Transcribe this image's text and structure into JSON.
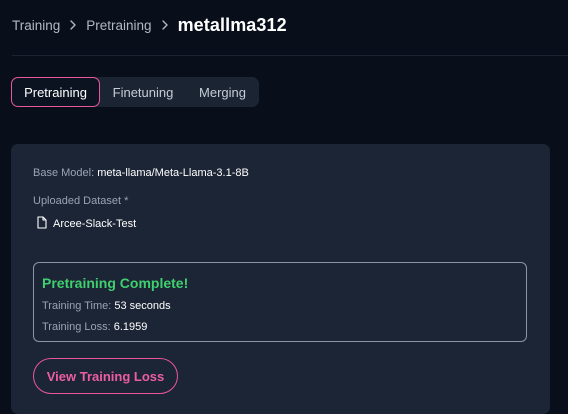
{
  "breadcrumb": {
    "items": [
      "Training",
      "Pretraining"
    ],
    "current": "metallma312"
  },
  "tabs": [
    {
      "label": "Pretraining",
      "active": true
    },
    {
      "label": "Finetuning",
      "active": false
    },
    {
      "label": "Merging",
      "active": false
    }
  ],
  "card": {
    "base_model_label": "Base Model:",
    "base_model_value": "meta-llama/Meta-Llama-3.1-8B",
    "dataset_label": "Uploaded Dataset *",
    "dataset_file": "Arcee-Slack-Test",
    "status": {
      "title": "Pretraining Complete!",
      "time_label": "Training Time:",
      "time_value": "53 seconds",
      "loss_label": "Training Loss:",
      "loss_value": "6.1959"
    },
    "view_button_label": "View Training Loss"
  },
  "colors": {
    "background": "#080e1a",
    "card": "#1c2535",
    "accent_pink": "#e9579a",
    "success_green": "#3fcf6e"
  },
  "icons": {
    "crumb_separator": "chevron-right-icon",
    "dataset_file": "file-icon"
  }
}
